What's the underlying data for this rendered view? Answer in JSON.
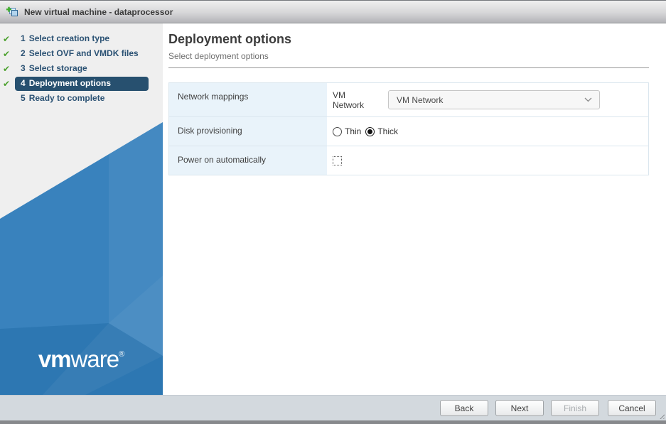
{
  "window": {
    "title": "New virtual machine - dataprocessor"
  },
  "steps": [
    {
      "number": "1",
      "label": "Select creation type",
      "completed": true,
      "active": false
    },
    {
      "number": "2",
      "label": "Select OVF and VMDK files",
      "completed": true,
      "active": false
    },
    {
      "number": "3",
      "label": "Select storage",
      "completed": true,
      "active": false
    },
    {
      "number": "4",
      "label": "Deployment options",
      "completed": true,
      "active": true
    },
    {
      "number": "5",
      "label": "Ready to complete",
      "completed": false,
      "active": false
    }
  ],
  "brand": {
    "logo_bold": "vm",
    "logo_light": "ware",
    "trademark": "®"
  },
  "page": {
    "title": "Deployment options",
    "subtitle": "Select deployment options"
  },
  "form": {
    "network_row": {
      "label": "Network mappings",
      "field_label": "VM Network",
      "selected_option": "VM Network"
    },
    "disk_row": {
      "label": "Disk provisioning",
      "options": [
        {
          "label": "Thin",
          "selected": false
        },
        {
          "label": "Thick",
          "selected": true
        }
      ]
    },
    "power_row": {
      "label": "Power on automatically",
      "checked": false
    }
  },
  "footer": {
    "back": "Back",
    "next": "Next",
    "finish": "Finish",
    "cancel": "Cancel"
  },
  "colors": {
    "sidebar_blue": "#2F7CBA",
    "active_step_bg": "#27506F",
    "step_text": "#2A5173",
    "check_green": "#4CA12E",
    "label_cell_bg": "#E9F3FA"
  }
}
